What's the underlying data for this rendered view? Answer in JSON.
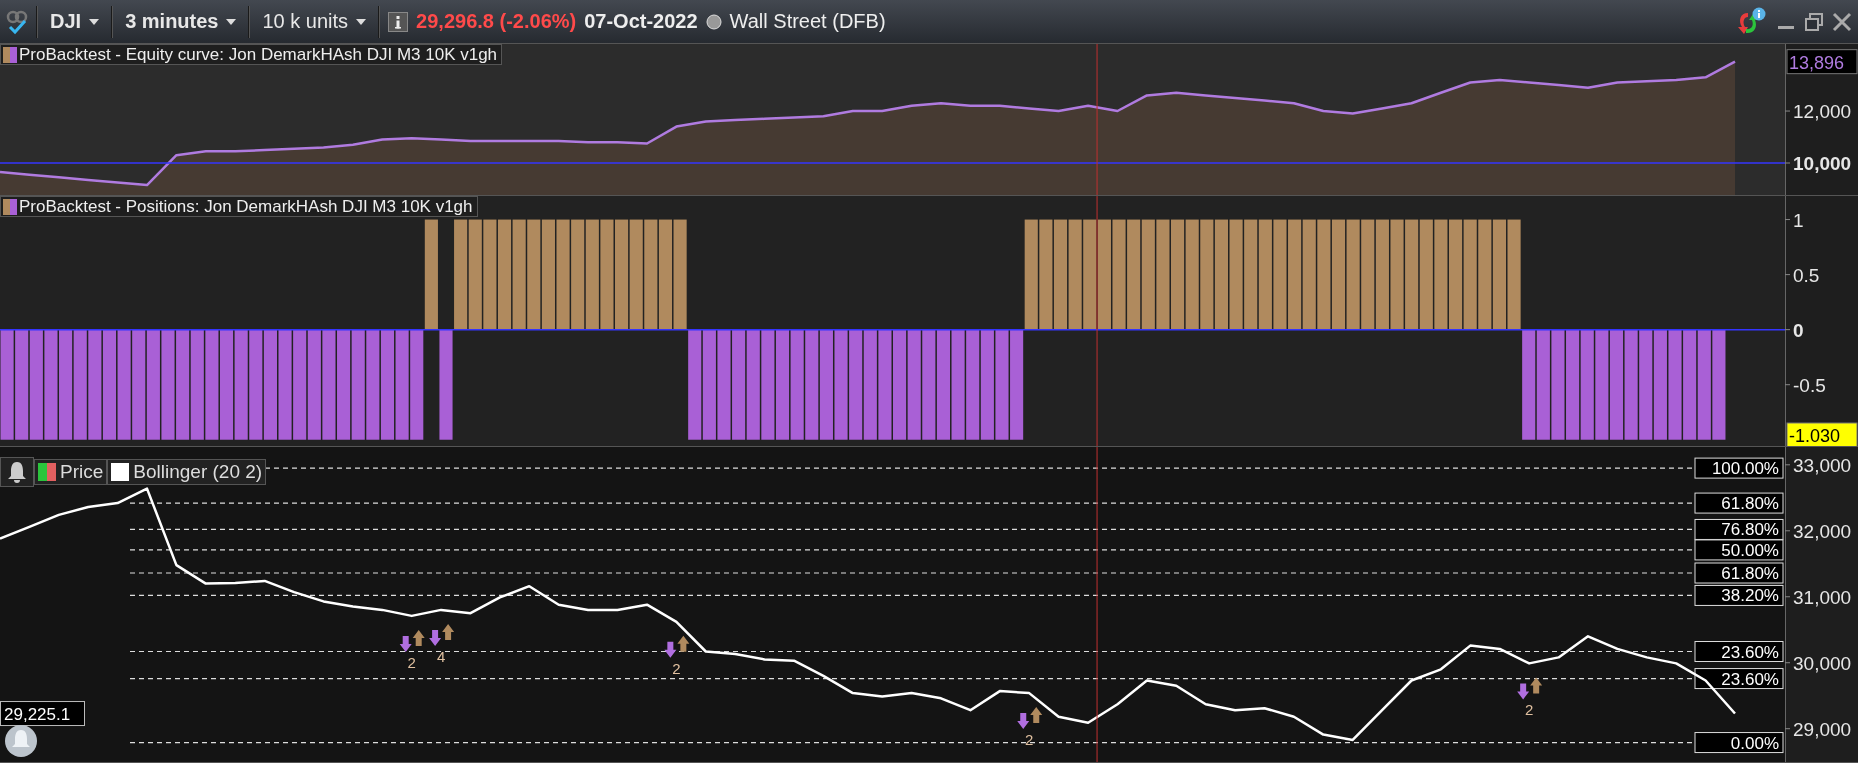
{
  "toolbar": {
    "instrument": "DJI",
    "timeframe": "3 minutes",
    "size": "10 k units",
    "price": "29,296.8 (-2.06%)",
    "date": "07-Oct-2022",
    "market": "Wall Street (DFB)"
  },
  "panels": [
    {
      "kind": "equity",
      "title": "ProBacktest - Equity curve: Jon DemarkHAsh DJI M3 10K v1gh",
      "axis_tag": "13,896",
      "chart_data": {
        "type": "line",
        "categories": [
          null,
          null,
          null,
          null,
          null,
          null,
          null,
          null,
          null,
          null,
          null,
          null,
          null,
          null,
          null,
          null,
          null,
          null,
          null,
          null,
          null,
          null,
          null,
          null,
          null,
          null,
          null,
          null,
          null,
          null,
          null,
          null,
          null,
          null,
          null,
          null,
          null,
          null,
          null,
          null,
          null,
          null,
          null,
          null,
          null,
          null,
          null,
          null,
          null,
          null,
          null,
          null,
          null,
          null,
          null,
          null,
          null,
          null,
          null,
          null
        ],
        "ylim": [
          8730,
          14580
        ],
        "yticks": [
          {
            "value": 12000,
            "label": "12,000"
          },
          {
            "value": 10000,
            "label": "10,000"
          }
        ],
        "series": [
          {
            "color": "#b07be0",
            "values": [
              9650,
              9550,
              9450,
              9350,
              9250,
              9150,
              10300,
              10450,
              10450,
              10500,
              10550,
              10600,
              10700,
              10900,
              10950,
              10900,
              10850,
              10850,
              10850,
              10850,
              10800,
              10800,
              10750,
              11400,
              11600,
              11650,
              11700,
              11750,
              11800,
              12000,
              12000,
              12200,
              12300,
              12200,
              12200,
              12100,
              12000,
              12200,
              12000,
              12600,
              12700,
              12600,
              12500,
              12400,
              12300,
              12000,
              11900,
              12100,
              12300,
              12700,
              13100,
              13200,
              13100,
              13000,
              12900,
              13100,
              13150,
              13200,
              13300,
              13900
            ]
          }
        ],
        "ref_lines": [
          {
            "axis": "y",
            "value": 10000
          }
        ]
      }
    },
    {
      "kind": "positions",
      "title": "ProBacktest - Positions: Jon DemarkHAsh DJI M3 10K v1gh",
      "axis_tag": "-1.030",
      "chart_data": {
        "type": "bar",
        "categories": [
          null,
          null,
          null,
          null,
          null,
          null,
          null,
          null,
          null,
          null,
          null,
          null,
          null,
          null,
          null,
          null,
          null,
          null,
          null,
          null,
          null,
          null,
          null,
          null,
          null,
          null,
          null,
          null,
          null,
          null,
          null,
          null,
          null,
          null,
          null,
          null,
          null,
          null,
          null,
          null,
          null,
          null,
          null,
          null,
          null,
          null,
          null,
          null,
          null,
          null,
          null,
          null,
          null,
          null,
          null,
          null,
          null,
          null,
          null,
          null,
          null,
          null,
          null,
          null,
          null,
          null,
          null,
          null,
          null,
          null,
          null,
          null,
          null,
          null,
          null,
          null,
          null,
          null,
          null,
          null,
          null,
          null,
          null,
          null,
          null,
          null,
          null,
          null,
          null,
          null,
          null,
          null,
          null,
          null,
          null,
          null,
          null,
          null,
          null,
          null,
          null,
          null,
          null,
          null,
          null,
          null,
          null,
          null,
          null,
          null,
          null,
          null,
          null,
          null,
          null,
          null,
          null,
          null,
          null,
          null,
          null,
          null
        ],
        "ylim": [
          -1.066,
          1.214
        ],
        "yticks": [
          {
            "value": 1,
            "label": "1"
          },
          {
            "value": 0.5,
            "label": "0.5"
          },
          {
            "value": 0,
            "label": "0"
          },
          {
            "value": -0.5,
            "label": "-0.5"
          }
        ],
        "series": [
          {
            "values": [
              -1,
              -1,
              -1,
              -1,
              -1,
              -1,
              -1,
              -1,
              -1,
              -1,
              -1,
              -1,
              -1,
              -1,
              -1,
              -1,
              -1,
              -1,
              -1,
              -1,
              -1,
              -1,
              -1,
              -1,
              -1,
              -1,
              -1,
              -1,
              -1,
              1,
              -1,
              1,
              1,
              1,
              1,
              1,
              1,
              1,
              1,
              1,
              1,
              1,
              1,
              1,
              1,
              1,
              1,
              -1,
              -1,
              -1,
              -1,
              -1,
              -1,
              -1,
              -1,
              -1,
              -1,
              -1,
              -1,
              -1,
              -1,
              -1,
              -1,
              -1,
              -1,
              -1,
              -1,
              -1,
              -1,
              -1,
              1,
              1,
              1,
              1,
              1,
              1,
              1,
              1,
              1,
              1,
              1,
              1,
              1,
              1,
              1,
              1,
              1,
              1,
              1,
              1,
              1,
              1,
              1,
              1,
              1,
              1,
              1,
              1,
              1,
              1,
              1,
              1,
              1,
              1,
              -1,
              -1,
              -1,
              -1,
              -1,
              -1,
              -1,
              -1,
              -1,
              -1,
              -1,
              -1,
              -1,
              -1,
              0,
              0,
              0,
              0
            ]
          }
        ],
        "ref_lines": [
          {
            "axis": "y",
            "value": 0
          }
        ]
      }
    },
    {
      "kind": "price",
      "legend": [
        {
          "kind": "candles",
          "label": "Price"
        },
        {
          "kind": "band",
          "label": "Bollinger (20 2)"
        }
      ],
      "price_tag": "29,225.1",
      "trade_markers": [
        {
          "label": "2"
        },
        {
          "label": "4"
        },
        {
          "label": "2"
        },
        {
          "label": "2"
        },
        {
          "label": "2"
        }
      ],
      "fib_labels": [
        "100.00%",
        "61.80%",
        "76.80%",
        "50.00%",
        "61.80%",
        "38.20%",
        "23.60%",
        "23.60%",
        "0.00%"
      ],
      "chart_data": {
        "type": "line",
        "categories": [
          null,
          null,
          null,
          null,
          null,
          null,
          null,
          null,
          null,
          null,
          null,
          null,
          null,
          null,
          null,
          null,
          null,
          null,
          null,
          null,
          null,
          null,
          null,
          null,
          null,
          null,
          null,
          null,
          null,
          null,
          null,
          null,
          null,
          null,
          null,
          null,
          null,
          null,
          null,
          null,
          null,
          null,
          null,
          null,
          null,
          null,
          null,
          null,
          null,
          null,
          null,
          null,
          null,
          null,
          null,
          null,
          null,
          null,
          null,
          null
        ],
        "ylim": [
          28480,
          33270
        ],
        "yticks": [
          {
            "value": 33000,
            "label": "33,000"
          },
          {
            "value": 32000,
            "label": "32,000"
          },
          {
            "value": 31000,
            "label": "31,000"
          },
          {
            "value": 30000,
            "label": "30,000"
          },
          {
            "value": 29000,
            "label": "29,000"
          }
        ],
        "series": [
          {
            "color": "#ffffff",
            "values": [
              31880,
              32060,
              32240,
              32360,
              32420,
              32640,
              31480,
              31200,
              31210,
              31240,
              31070,
              30930,
              30850,
              30800,
              30710,
              30800,
              30750,
              30990,
              31160,
              30880,
              30800,
              30800,
              30880,
              30620,
              30170,
              30130,
              30050,
              30030,
              29800,
              29540,
              29490,
              29540,
              29460,
              29280,
              29570,
              29540,
              29180,
              29090,
              29370,
              29730,
              29650,
              29370,
              29280,
              29310,
              29180,
              28910,
              28830,
              29280,
              29730,
              29900,
              30260,
              30210,
              29990,
              30080,
              30400,
              30210,
              30080,
              29990,
              29730,
              29230
            ]
          }
        ],
        "ref_lines": [
          {
            "axis": "y",
            "value": 32950
          },
          {
            "axis": "y",
            "value": 32420
          },
          {
            "axis": "y",
            "value": 32020
          },
          {
            "axis": "y",
            "value": 31710
          },
          {
            "axis": "y",
            "value": 31360
          },
          {
            "axis": "y",
            "value": 31020
          },
          {
            "axis": "y",
            "value": 30170
          },
          {
            "axis": "y",
            "value": 29760
          },
          {
            "axis": "y",
            "value": 28790
          }
        ]
      }
    }
  ]
}
